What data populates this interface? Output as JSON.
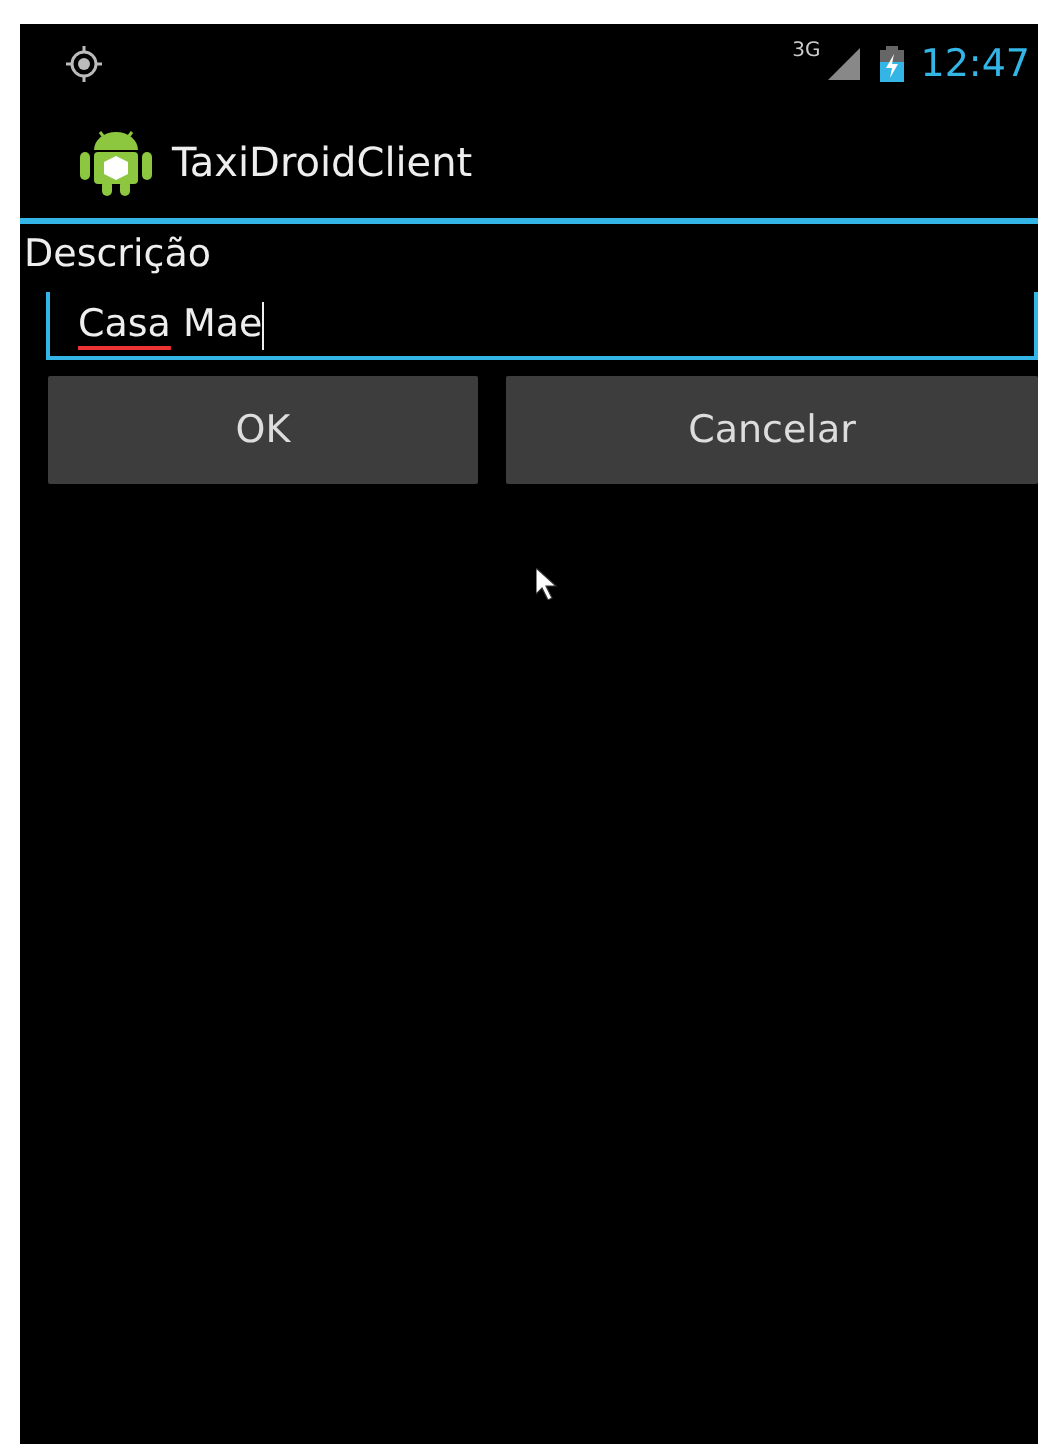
{
  "status_bar": {
    "network": "3G",
    "time": "12:47"
  },
  "action_bar": {
    "title": "TaxiDroidClient"
  },
  "form": {
    "label": "Descrição",
    "field": {
      "focused": true,
      "words": [
        {
          "text": "Casa",
          "misspelled": true
        },
        {
          "text": "Mae",
          "misspelled": false
        }
      ]
    }
  },
  "buttons": [
    {
      "label": "OK"
    },
    {
      "label": "Cancelar"
    }
  ]
}
